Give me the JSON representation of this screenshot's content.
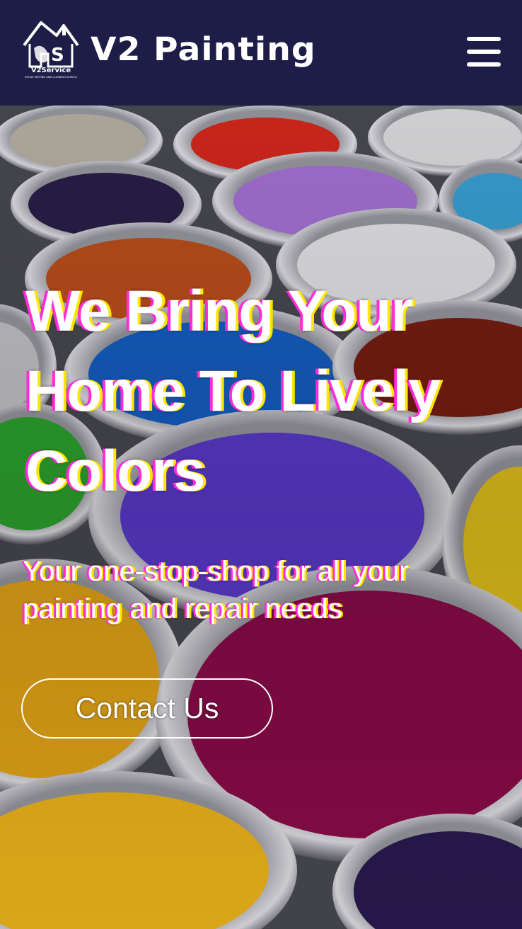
{
  "navbar": {
    "logo_text": "V2Service",
    "logo_tagline": "HOUSE KEEPING AND CLEANING SERVICE",
    "brand_name": "V2 Painting",
    "menu_icon": "hamburger-menu-icon"
  },
  "hero": {
    "background": "paint-cans-photo",
    "headline": "We Bring Your Home To Lively Colors",
    "subheadline": "Your one-stop-shop for all your painting and repair needs",
    "cta_label": "Contact Us"
  },
  "colors": {
    "nav_background": "#1d1d47",
    "text": "#ffffff",
    "accent_pink": "#ff2bd6",
    "accent_yellow": "#ffe600"
  }
}
